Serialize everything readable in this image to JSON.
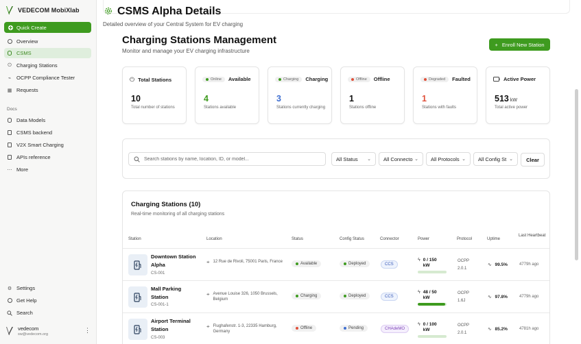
{
  "sidebar": {
    "brand": "VEDECOM MobiXlab",
    "quick_create": "Quick Create",
    "items": [
      {
        "label": "Overview",
        "icon": "overview-icon"
      },
      {
        "label": "CSMS",
        "icon": "database-icon",
        "active": true
      },
      {
        "label": "Charging Stations",
        "icon": "power-icon"
      },
      {
        "label": "OCPP Compliance Tester",
        "icon": "plug-icon"
      },
      {
        "label": "Requests",
        "icon": "grid-icon"
      }
    ],
    "docs_label": "Docs",
    "docs": [
      {
        "label": "Data Models",
        "icon": "database-icon"
      },
      {
        "label": "CSMS backend",
        "icon": "server-icon"
      },
      {
        "label": "V2X Smart Charging",
        "icon": "document-icon"
      },
      {
        "label": "APIs reference",
        "icon": "document-icon"
      },
      {
        "label": "More",
        "icon": "more-icon"
      }
    ],
    "bottom": [
      {
        "label": "Settings",
        "icon": "gear-icon"
      },
      {
        "label": "Get Help",
        "icon": "help-icon"
      },
      {
        "label": "Search",
        "icon": "search-icon"
      }
    ],
    "user": {
      "name": "vedecom",
      "email": "sw@vedecom.org"
    }
  },
  "header": {
    "title": "CSMS Alpha Details",
    "subtitle": "Detailed overview of your Central System for EV charging"
  },
  "management": {
    "title": "Charging Stations Management",
    "subtitle": "Monitor and manage your EV charging infrastructure",
    "enroll_label": "Enroll New Station"
  },
  "stats": [
    {
      "title": "Total Stations",
      "value": "10",
      "desc": "Total number of stations",
      "color": "#111111"
    },
    {
      "pill": "Online",
      "pill_color": "#3e9b1f",
      "title": "Available",
      "value": "4",
      "desc": "Stations available",
      "color": "#3e9b1f"
    },
    {
      "pill": "Charging",
      "pill_color": "#3e9b1f",
      "title": "Charging",
      "value": "3",
      "desc": "Stations currently charging",
      "color": "#3f6fd1"
    },
    {
      "pill": "Offline",
      "pill_color": "#e0503a",
      "title": "Offline",
      "value": "1",
      "desc": "Stations offline",
      "color": "#111111"
    },
    {
      "pill": "Degraded",
      "pill_color": "#e0503a",
      "title": "Faulted",
      "value": "1",
      "desc": "Stations with faults",
      "color": "#e0503a"
    },
    {
      "title": "Active Power",
      "value": "513",
      "unit": "kW",
      "desc": "Total active power",
      "color": "#111111"
    }
  ],
  "filters": {
    "search_placeholder": "Search stations by name, location, ID, or model...",
    "status": "All Status",
    "connectors": "All Connecto",
    "protocols": "All Protocols",
    "config": "All Config St",
    "clear": "Clear"
  },
  "table": {
    "title": "Charging Stations (10)",
    "subtitle": "Real-time monitoring of all charging stations",
    "columns": [
      "Station",
      "Location",
      "Status",
      "Config Status",
      "Connector",
      "Power",
      "Protocol",
      "Uptime",
      "Last Heartbeat"
    ],
    "rows": [
      {
        "name": "Downtown Station Alpha",
        "id": "CS-001",
        "location": "12 Rue de Rivoli, 75001 Paris, France",
        "status": "Available",
        "status_color": "#3e9b1f",
        "config": "Deployed",
        "config_color": "#3e9b1f",
        "connector": "CCS",
        "power": "0 / 150 kW",
        "power_fraction": 0.0,
        "protocol": "OCPP 2.0.1",
        "uptime": "99.5%",
        "heartbeat": "4779h ago"
      },
      {
        "name": "Mall Parking Station",
        "id": "CS-001-1",
        "location": "Avenue Louise 326, 1050 Brussels, Belgium",
        "status": "Charging",
        "status_color": "#3e9b1f",
        "config": "Deployed",
        "config_color": "#3e9b1f",
        "connector": "CCS",
        "power": "48 / 50 kW",
        "power_fraction": 0.96,
        "protocol": "OCPP 1.6J",
        "uptime": "97.8%",
        "heartbeat": "4779h ago"
      },
      {
        "name": "Airport Terminal Station",
        "id": "CS-003",
        "location": "Flughafenstr. 1-3, 22335 Hamburg, Germany",
        "status": "Offline",
        "status_color": "#e0503a",
        "config": "Pending",
        "config_color": "#3f6fd1",
        "connector": "CHAdeMO",
        "power": "0 / 100 kW",
        "power_fraction": 0.0,
        "protocol": "OCPP 2.0.1",
        "uptime": "85.2%",
        "heartbeat": "4781h ago"
      }
    ]
  }
}
